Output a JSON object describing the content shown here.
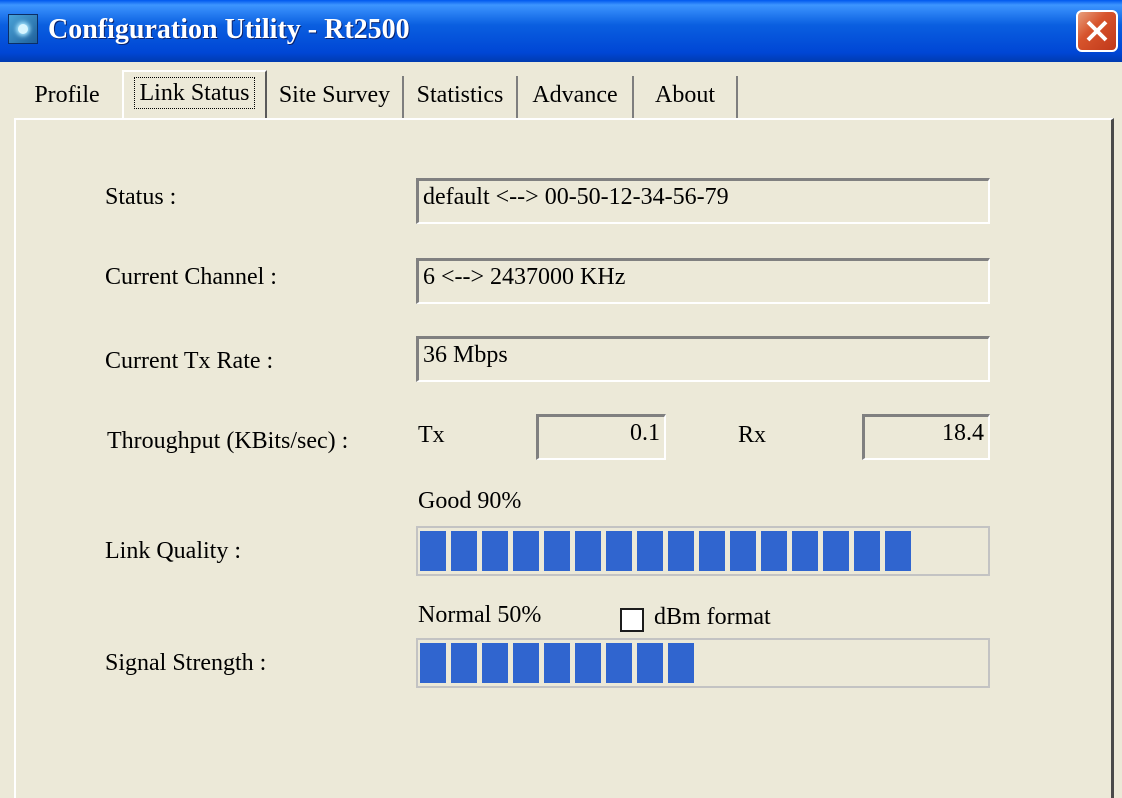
{
  "window": {
    "title": "Configuration Utility - Rt2500"
  },
  "tabs": [
    {
      "label": "Profile"
    },
    {
      "label": "Link Status"
    },
    {
      "label": "Site Survey"
    },
    {
      "label": "Statistics"
    },
    {
      "label": "Advance"
    },
    {
      "label": "About"
    }
  ],
  "active_tab": "Link Status",
  "status": {
    "label": "Status :",
    "value": "default <--> 00-50-12-34-56-79"
  },
  "channel": {
    "label": "Current Channel :",
    "value": "6 <--> 2437000 KHz"
  },
  "tx_rate": {
    "label": "Current Tx Rate :",
    "value": "36 Mbps"
  },
  "throughput": {
    "label": "Throughput (KBits/sec) :",
    "tx_label": "Tx",
    "tx_value": "0.1",
    "rx_label": "Rx",
    "rx_value": "18.4"
  },
  "link_quality": {
    "label": "Link Quality :",
    "text": "Good 90%",
    "percent": 90
  },
  "signal_strength": {
    "label": "Signal Strength :",
    "text": "Normal 50%",
    "percent": 50,
    "dbm_label": "dBm format",
    "dbm_checked": false
  },
  "colors": {
    "progress": "#3065cf",
    "titlebar": "#0a5fe0",
    "close": "#d7542c"
  },
  "icons": {
    "app": "app-icon",
    "close": "close-icon"
  }
}
